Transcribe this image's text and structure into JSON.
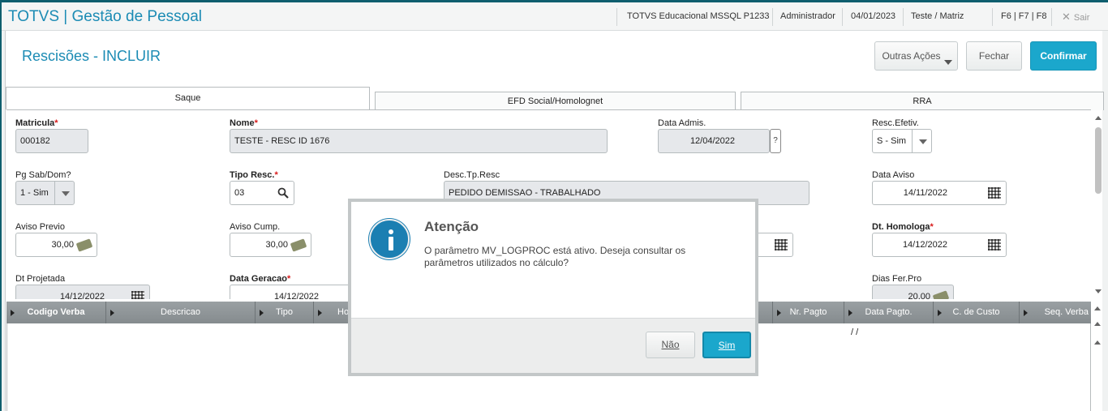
{
  "header": {
    "app_title": "TOTVS | Gestão de Pessoal",
    "environment": "TOTVS Educacional MSSQL P1233",
    "user": "Administrador",
    "date": "04/01/2023",
    "company": "Teste / Matriz",
    "shortcuts": "F6 | F7 | F8",
    "exit_label": "Sair"
  },
  "page": {
    "title": "Rescisões - INCLUIR",
    "more_actions": "Outras Ações",
    "close": "Fechar",
    "confirm": "Confirmar"
  },
  "tabs": [
    "Saque",
    "EFD Social/Homolognet",
    "RRA"
  ],
  "fields": {
    "matricula": {
      "label": "Matricula",
      "value": "000182"
    },
    "nome": {
      "label": "Nome",
      "value": "TESTE - RESC ID 1676"
    },
    "data_admis": {
      "label": "Data Admis.",
      "value": "12/04/2022",
      "help": "?"
    },
    "resc_efetiv": {
      "label": "Resc.Efetiv.",
      "value": "S - Sim"
    },
    "pg_sab_dom": {
      "label": "Pg Sab/Dom?",
      "value": "1 - Sim"
    },
    "tipo_resc": {
      "label": "Tipo Resc.",
      "value": "03"
    },
    "desc_tp_resc": {
      "label": "Desc.Tp.Resc",
      "value": "PEDIDO DEMISSAO - TRABALHADO"
    },
    "data_aviso": {
      "label": "Data Aviso",
      "value": "14/11/2022"
    },
    "aviso_previo": {
      "label": "Aviso Previo",
      "value": "30,00"
    },
    "aviso_cump": {
      "label": "Aviso Cump.",
      "value": "30,00"
    },
    "dt_homologa": {
      "label": "Dt. Homologa",
      "value": "14/12/2022"
    },
    "dt_projetada": {
      "label": "Dt Projetada",
      "value": "14/12/2022"
    },
    "data_geracao": {
      "label": "Data Geracao",
      "value": "14/12/2022"
    },
    "dias_fer_pro": {
      "label": "Dias Fer.Pro",
      "value": "20,00"
    }
  },
  "required_mark": "*",
  "grid": {
    "columns": [
      "Codigo Verba",
      "Descricao",
      "Tipo",
      "Ho",
      "Nr. Pagto",
      "Data Pagto.",
      "C. de Custo",
      "Seq. Verba"
    ],
    "row_placeholder": "/ /"
  },
  "dialog": {
    "title": "Atenção",
    "message": "O parâmetro MV_LOGPROC está ativo. Deseja consultar os parâmetros utilizados no cálculo?",
    "no_label": "Não",
    "yes_label": "Sim"
  },
  "colors": {
    "accent": "#1b8bb4",
    "primary_button": "#1ba7cc",
    "required": "#d81b1b",
    "grid_header": "#8f9598",
    "info_icon": "#1b7fb2"
  }
}
